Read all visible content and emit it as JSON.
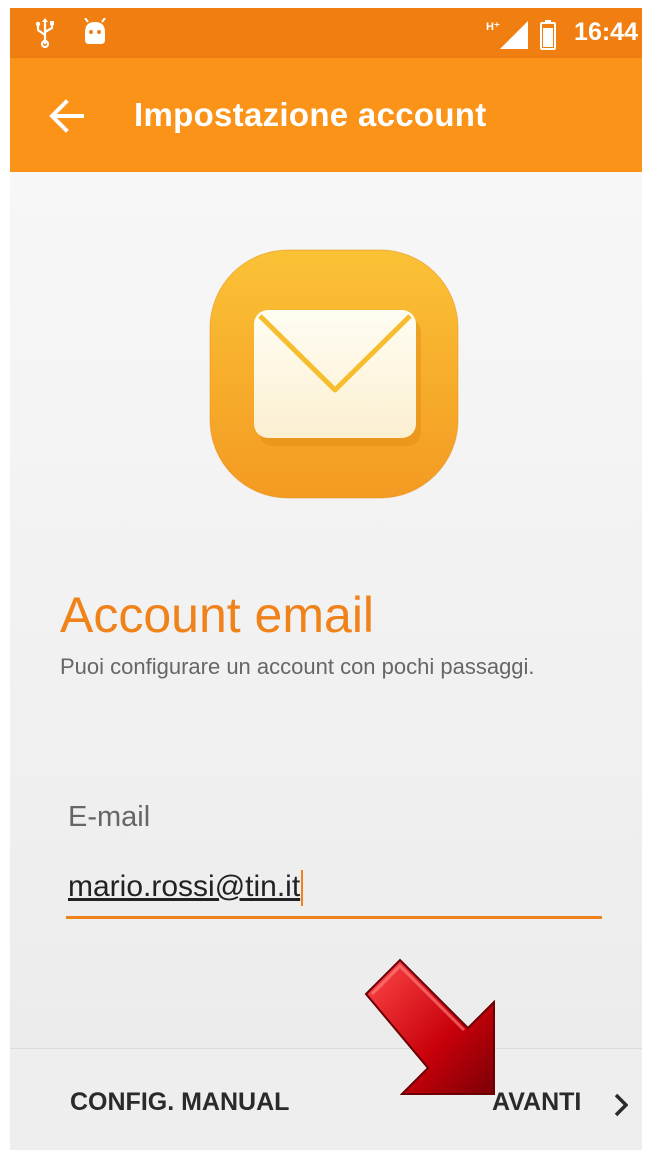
{
  "status_bar": {
    "time": "16:44",
    "network_label": "H⁺",
    "icons": [
      "usb-icon",
      "android-debug-icon",
      "signal-icon",
      "battery-icon"
    ]
  },
  "app_bar": {
    "title": "Impostazione account",
    "back_icon": "arrow-left-icon"
  },
  "main": {
    "logo_icon": "email-envelope-icon",
    "heading": "Account email",
    "subtitle": "Puoi configurare un account con pochi passaggi.",
    "email_label": "E-mail",
    "email_value": "mario.rossi@tin.it"
  },
  "bottom_bar": {
    "manual_label": "CONFIG. MANUAL",
    "next_label": "AVANTI",
    "next_icon": "chevron-right-icon"
  },
  "colors": {
    "status_bar": "#f07e10",
    "app_bar": "#fb9318",
    "accent": "#f0821a",
    "annotation_arrow": "#c8000a"
  }
}
